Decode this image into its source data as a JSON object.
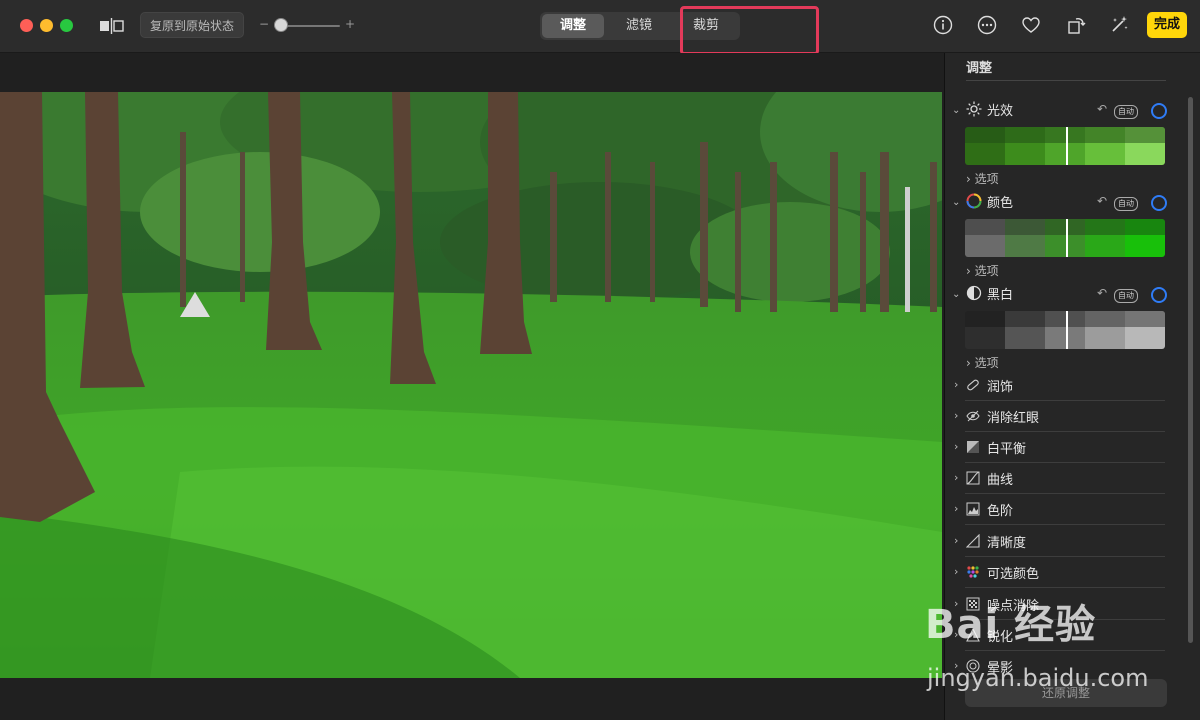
{
  "toolbar": {
    "revert_label": "复原到原始状态",
    "zoom_minus": "−",
    "zoom_plus": "+",
    "zoom_level": 0.1,
    "done_label": "完成"
  },
  "tabs": [
    {
      "label": "调整",
      "active": true
    },
    {
      "label": "滤镜",
      "active": false
    },
    {
      "label": "裁剪",
      "active": false
    }
  ],
  "toolbar_icons": [
    "info-icon",
    "more-icon",
    "heart-icon",
    "rotate-icon",
    "magic-wand-icon"
  ],
  "sidebar": {
    "title": "调整",
    "sections": [
      {
        "label": "光效",
        "icon": "sun-icon",
        "auto": "自动",
        "options": "选项"
      },
      {
        "label": "颜色",
        "icon": "color-wheel-icon",
        "auto": "自动",
        "options": "选项"
      },
      {
        "label": "黑白",
        "icon": "half-circle-icon",
        "auto": "自动",
        "options": "选项"
      }
    ],
    "rows": [
      {
        "label": "润饰",
        "icon": "bandage-icon"
      },
      {
        "label": "消除红眼",
        "icon": "eye-icon"
      },
      {
        "label": "白平衡",
        "icon": "white-balance-icon"
      },
      {
        "label": "曲线",
        "icon": "curves-icon"
      },
      {
        "label": "色阶",
        "icon": "levels-icon"
      },
      {
        "label": "清晰度",
        "icon": "definition-icon"
      },
      {
        "label": "可选颜色",
        "icon": "selective-color-icon"
      },
      {
        "label": "噪点消除",
        "icon": "noise-icon"
      },
      {
        "label": "锐化",
        "icon": "sharpen-icon"
      },
      {
        "label": "晕影",
        "icon": "vignette-icon"
      }
    ],
    "reset_label": "还原调整"
  },
  "watermark": {
    "brand": "Bai 经验",
    "url": "jingyan.baidu.com"
  },
  "colors": {
    "accent_yellow": "#ffd60a",
    "highlight_red": "#e33a5a",
    "toggle_blue": "#2f7cf6"
  }
}
